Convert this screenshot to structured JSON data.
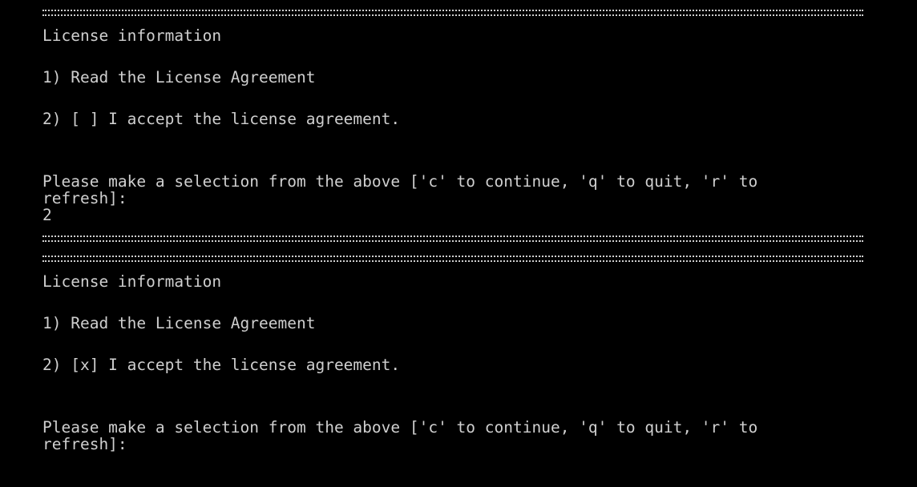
{
  "terminal": {
    "block1": {
      "title": "License information",
      "option1": "1) Read the License Agreement",
      "option2": "2) [ ] I accept the license agreement.",
      "prompt_line1": "Please make a selection from the above ['c' to continue, 'q' to quit, 'r' to",
      "prompt_line2": "refresh]:",
      "user_input": "2"
    },
    "block2": {
      "title": "License information",
      "option1": "1) Read the License Agreement",
      "option2": "2) [x] I accept the license agreement.",
      "prompt_line1": "Please make a selection from the above ['c' to continue, 'q' to quit, 'r' to",
      "prompt_line2": "refresh]:"
    }
  }
}
